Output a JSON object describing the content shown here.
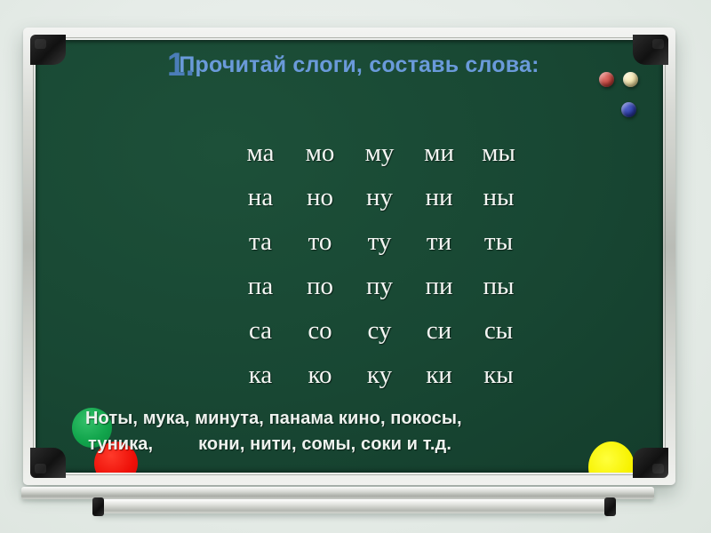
{
  "slide": {
    "headline": {
      "number": "1.",
      "text": "Прочитай слоги, составь слова:"
    },
    "syllable_rows": [
      [
        "ма",
        "мо",
        "му",
        "ми",
        "мы"
      ],
      [
        "на",
        "но",
        "ну",
        "ни",
        "ны"
      ],
      [
        "та",
        "то",
        "ту",
        "ти",
        "ты"
      ],
      [
        "па",
        "по",
        "пу",
        "пи",
        "пы"
      ],
      [
        "са",
        "со",
        "су",
        "си",
        "сы"
      ],
      [
        "ка",
        "ко",
        "ку",
        "ки",
        "кы"
      ]
    ],
    "answers": {
      "line1": "Ноты, мука, минута, панама кино, покосы,",
      "line2": "туника,         кони, нити, сомы, соки и т.д."
    },
    "magnets": [
      {
        "name": "magnet-red-small",
        "color": "#c4433c"
      },
      {
        "name": "magnet-cream-small",
        "color": "#f0e1a4"
      },
      {
        "name": "magnet-blue-small",
        "color": "#2b3ba4"
      },
      {
        "name": "magnet-green-big",
        "color": "#12a54c"
      },
      {
        "name": "magnet-red-big",
        "color": "#ee1008"
      },
      {
        "name": "magnet-yellow-big",
        "color": "#f7f200"
      }
    ],
    "colors": {
      "board_green": "#184733",
      "frame_silver": "#c9ccc6",
      "headline_blue": "#6a9ada",
      "number_blue": "#4b7db8",
      "chalk_white": "#f4f6f3",
      "background": "#e8eeea"
    }
  }
}
